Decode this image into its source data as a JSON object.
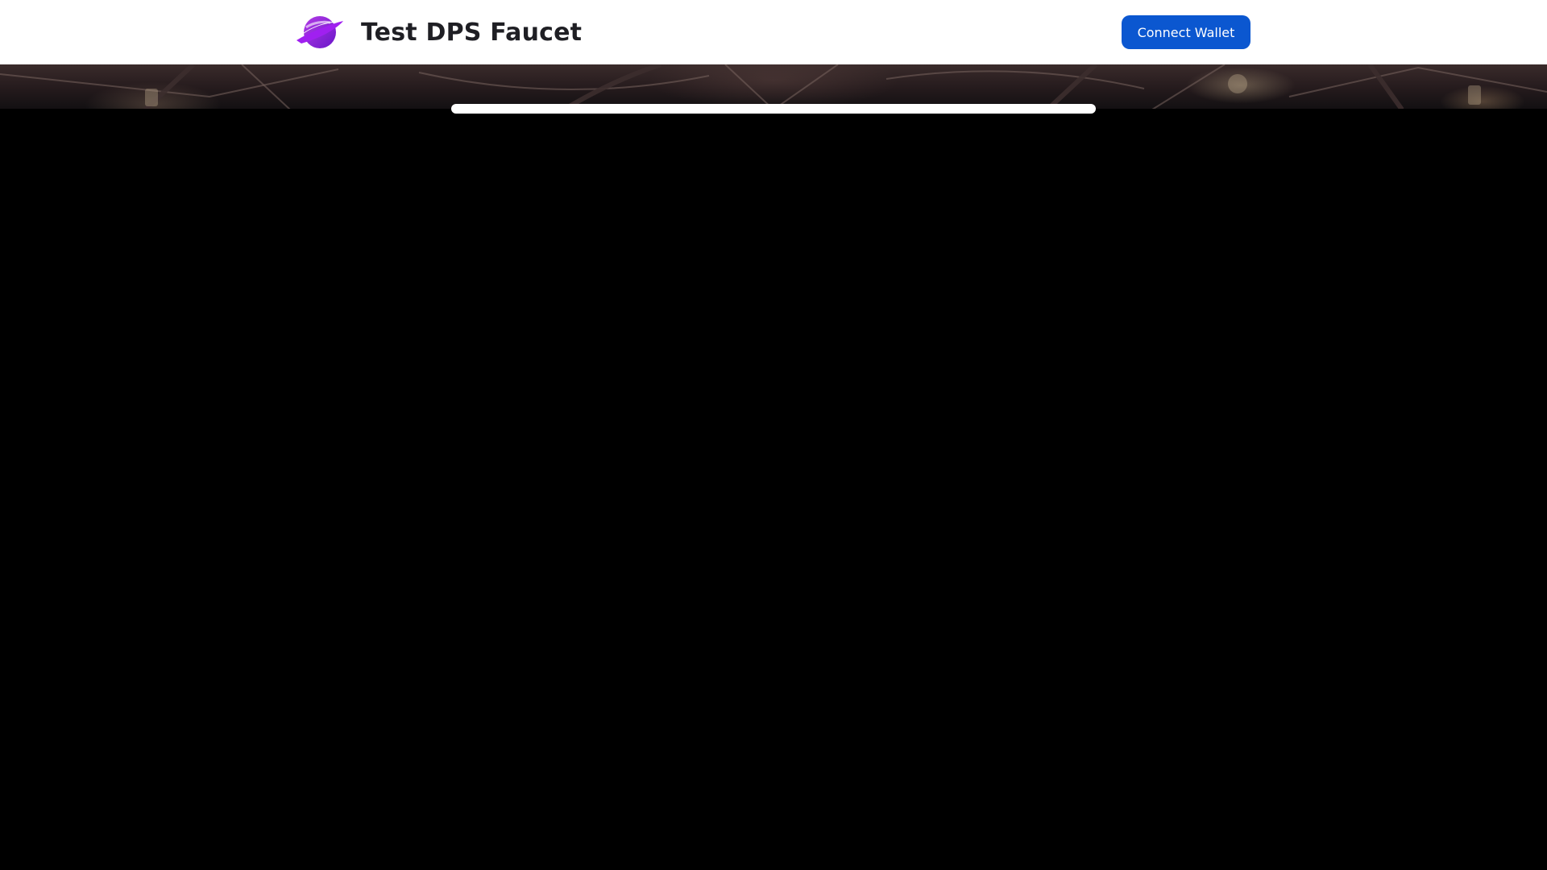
{
  "header": {
    "logo_icon": "planet-logo-icon",
    "title": "Test DPS Faucet",
    "connect_label": "Connect Wallet"
  },
  "colors": {
    "accent": "#0b57d0",
    "logo_purple": "#8a2be2",
    "background": "#000000"
  }
}
